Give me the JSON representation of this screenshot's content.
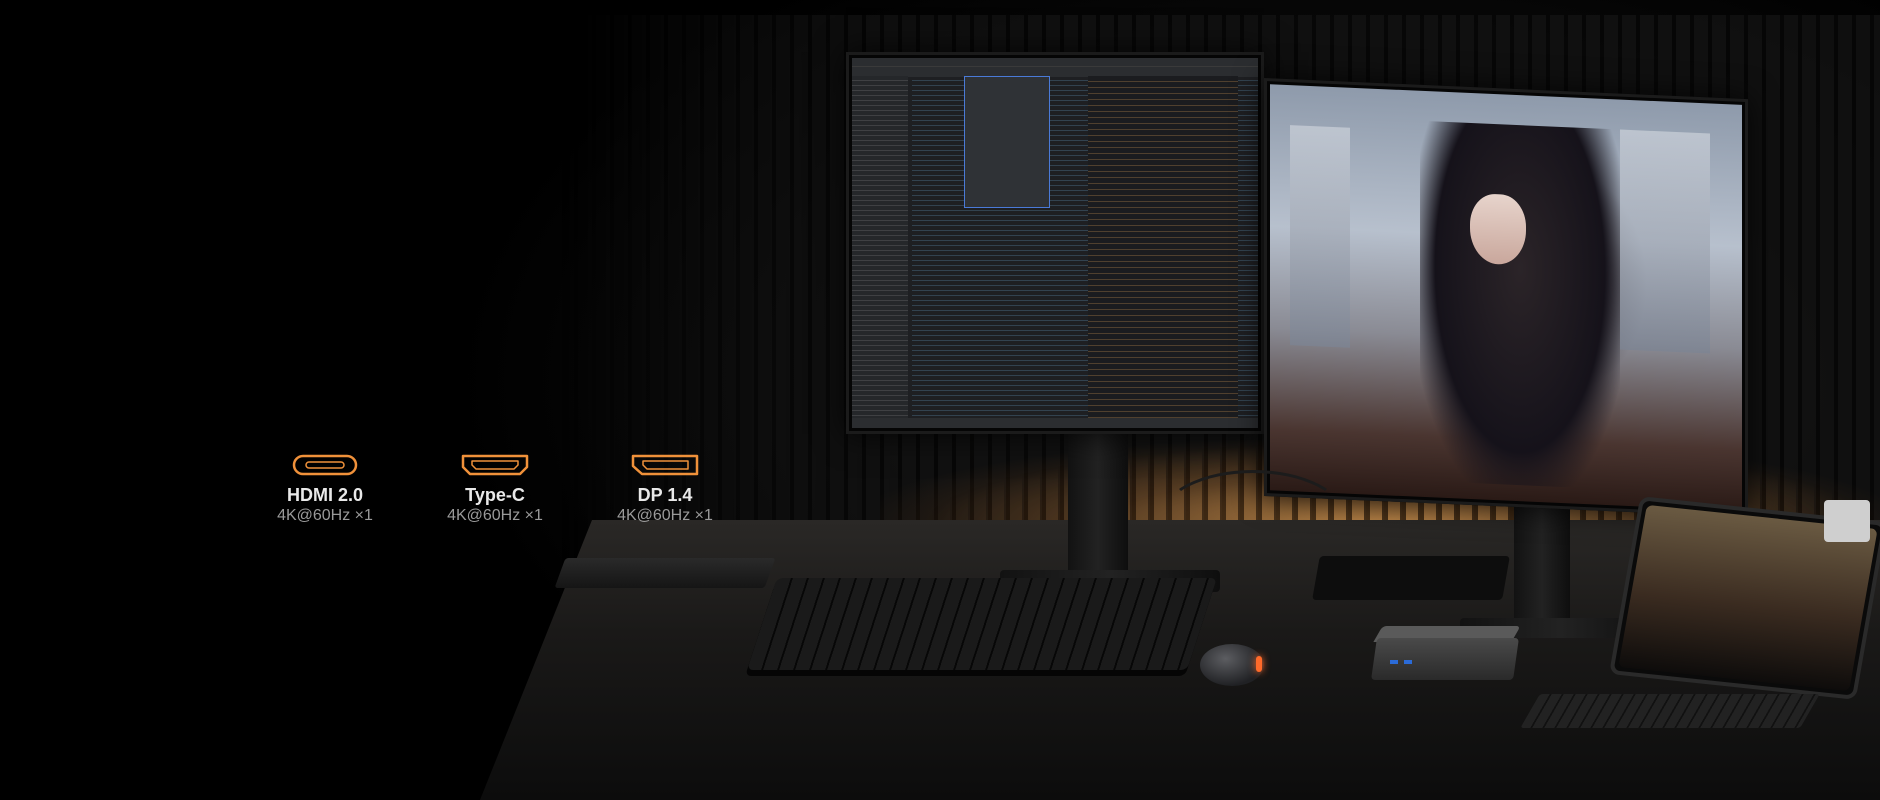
{
  "ports": [
    {
      "name": "HDMI 2.0",
      "spec": "4K@60Hz ×1",
      "icon": "usb-c-port-icon"
    },
    {
      "name": "Type-C",
      "spec": "4K@60Hz ×1",
      "icon": "hdmi-port-icon"
    },
    {
      "name": "DP 1.4",
      "spec": "4K@60Hz ×1",
      "icon": "displayport-port-icon"
    }
  ],
  "colors": {
    "accent": "#f0913a",
    "background": "#000000",
    "name_text": "#e9e9e9",
    "spec_text": "#9a9a9a"
  }
}
